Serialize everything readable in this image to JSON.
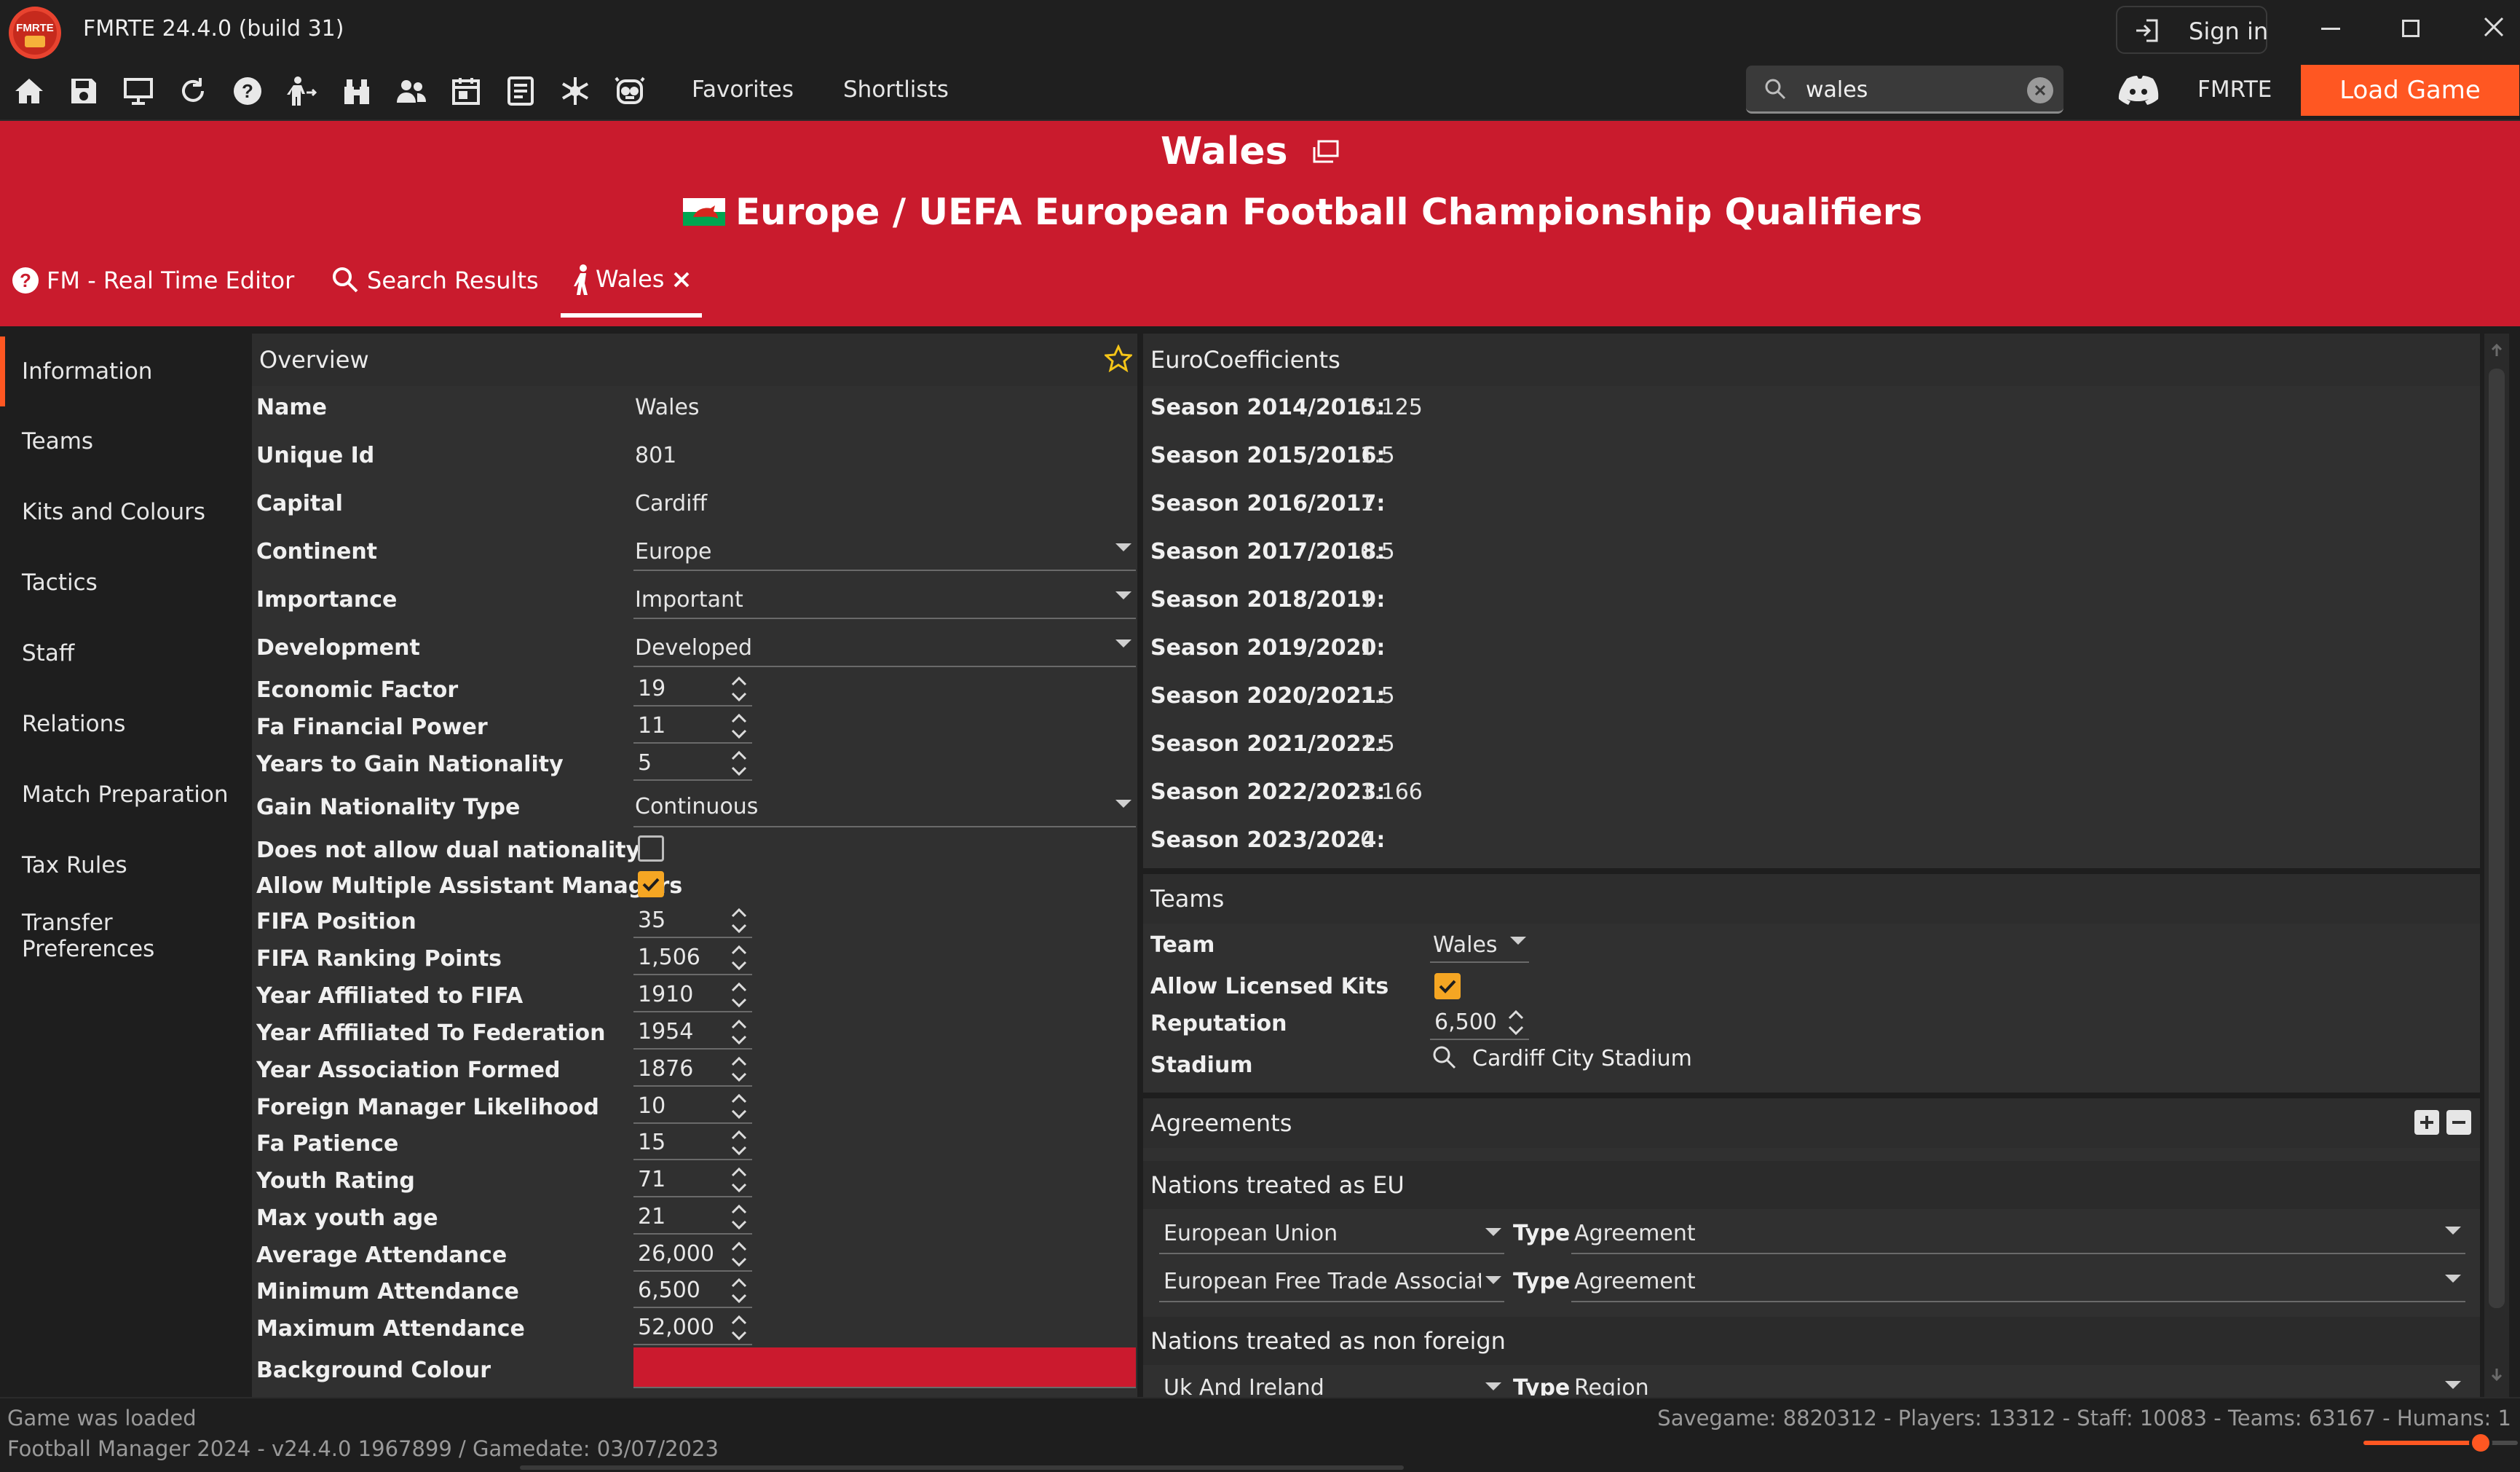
{
  "app": {
    "title": "FMRTE 24.4.0 (build 31)",
    "logo_text": "FMRTE",
    "sign_in_label": "Sign in"
  },
  "toolbar": {
    "icons": [
      "home-icon",
      "save-icon",
      "monitor-icon",
      "refresh-icon",
      "help-icon",
      "transfer-icon",
      "binoculars-icon",
      "people-icon",
      "calendar-icon",
      "list-icon",
      "snowflake-icon",
      "robot-icon"
    ],
    "favorites_label": "Favorites",
    "shortlists_label": "Shortlists",
    "search_value": "wales",
    "fmrte_label": "FMRTE",
    "load_game_label": "Load Game"
  },
  "header": {
    "title": "Wales",
    "subtitle": "Europe / UEFA European Football Championship Qualifiers"
  },
  "tabs": [
    {
      "label": "FM - Real Time Editor"
    },
    {
      "label": "Search Results"
    },
    {
      "label": "Wales"
    }
  ],
  "sidebar": {
    "items": [
      {
        "label": "Information"
      },
      {
        "label": "Teams"
      },
      {
        "label": "Kits and Colours"
      },
      {
        "label": "Tactics"
      },
      {
        "label": "Staff"
      },
      {
        "label": "Relations"
      },
      {
        "label": "Match Preparation"
      },
      {
        "label": "Tax Rules"
      },
      {
        "label": "Transfer Preferences"
      }
    ]
  },
  "overview": {
    "title": "Overview",
    "fields": {
      "name": {
        "label": "Name",
        "value": "Wales"
      },
      "unique_id": {
        "label": "Unique Id",
        "value": "801"
      },
      "capital": {
        "label": "Capital",
        "value": "Cardiff"
      },
      "continent": {
        "label": "Continent",
        "value": "Europe"
      },
      "importance": {
        "label": "Importance",
        "value": "Important"
      },
      "development": {
        "label": "Development",
        "value": "Developed"
      },
      "economic_factor": {
        "label": "Economic Factor",
        "value": "19"
      },
      "fa_financial_power": {
        "label": "Fa Financial Power",
        "value": "11"
      },
      "years_to_gain_nationality": {
        "label": "Years to Gain Nationality",
        "value": "5"
      },
      "gain_nationality_type": {
        "label": "Gain Nationality Type",
        "value": "Continuous"
      },
      "no_dual_nationality": {
        "label": "Does not allow dual nationality",
        "checked": false
      },
      "multiple_assistant_managers": {
        "label": "Allow Multiple Assistant Managers",
        "checked": true
      },
      "fifa_position": {
        "label": "FIFA Position",
        "value": "35"
      },
      "fifa_ranking_points": {
        "label": "FIFA Ranking Points",
        "value": "1,506"
      },
      "year_affiliated_fifa": {
        "label": "Year Affiliated to FIFA",
        "value": "1910"
      },
      "year_affiliated_federation": {
        "label": "Year Affiliated To Federation",
        "value": "1954"
      },
      "year_association_formed": {
        "label": "Year Association Formed",
        "value": "1876"
      },
      "foreign_manager_likelihood": {
        "label": "Foreign Manager Likelihood",
        "value": "10"
      },
      "fa_patience": {
        "label": "Fa Patience",
        "value": "15"
      },
      "youth_rating": {
        "label": "Youth Rating",
        "value": "71"
      },
      "max_youth_age": {
        "label": "Max youth age",
        "value": "21"
      },
      "average_attendance": {
        "label": "Average Attendance",
        "value": "26,000"
      },
      "minimum_attendance": {
        "label": "Minimum Attendance",
        "value": "6,500"
      },
      "maximum_attendance": {
        "label": "Maximum Attendance",
        "value": "52,000"
      },
      "background_colour": {
        "label": "Background Colour",
        "color": "#cb1a2e"
      }
    }
  },
  "eurocoefficients": {
    "title": "EuroCoefficients",
    "seasons": [
      {
        "label": "Season 2014/2015:",
        "value": "0.125"
      },
      {
        "label": "Season 2015/2016:",
        "value": "1.5"
      },
      {
        "label": "Season 2016/2017:",
        "value": "1"
      },
      {
        "label": "Season 2017/2018:",
        "value": "0.5"
      },
      {
        "label": "Season 2018/2019:",
        "value": "1"
      },
      {
        "label": "Season 2019/2020:",
        "value": "1"
      },
      {
        "label": "Season 2020/2021:",
        "value": "1.5"
      },
      {
        "label": "Season 2021/2022:",
        "value": "1.5"
      },
      {
        "label": "Season 2022/2023:",
        "value": "1.166"
      },
      {
        "label": "Season 2023/2024:",
        "value": "0"
      }
    ]
  },
  "teams": {
    "title": "Teams",
    "team_label": "Team",
    "team_value": "Wales",
    "licensed_kits_label": "Allow Licensed Kits",
    "licensed_kits_checked": true,
    "reputation_label": "Reputation",
    "reputation_value": "6,500",
    "stadium_label": "Stadium",
    "stadium_value": "Cardiff City Stadium"
  },
  "agreements": {
    "title": "Agreements",
    "eu_title": "Nations treated as EU",
    "eu_rows": [
      {
        "name": "European Union",
        "type_label": "Type",
        "type_value": "Agreement"
      },
      {
        "name": "European Free Trade Associatic",
        "type_label": "Type",
        "type_value": "Agreement"
      }
    ],
    "non_foreign_title": "Nations treated as non foreign",
    "non_foreign_rows": [
      {
        "name": "Uk And Ireland",
        "type_label": "Type",
        "type_value": "Region"
      }
    ]
  },
  "status": {
    "message": "Game was loaded",
    "version": "Football Manager 2024 - v24.4.0 1967899 / Gamedate: 03/07/2023",
    "stats": "Savegame: 8820312 - Players: 13312 - Staff: 10083 - Teams: 63167 - Humans: 1",
    "zoom_fraction": 0.76
  },
  "colors": {
    "accent": "#ff5722",
    "header_red": "#c91b2d",
    "check_orange": "#f5a623"
  }
}
